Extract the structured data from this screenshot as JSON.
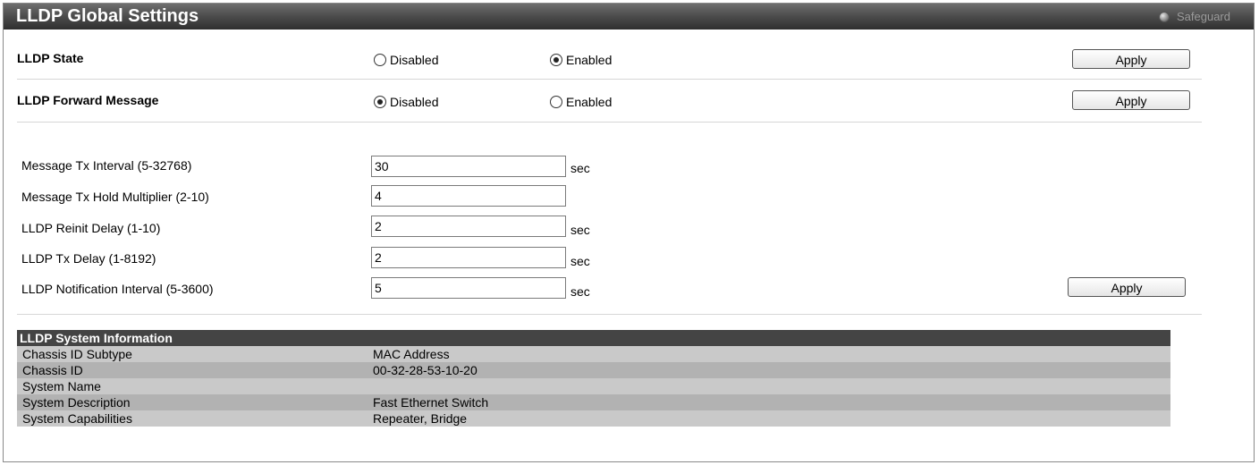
{
  "title": "LLDP Global Settings",
  "safeguard": {
    "label": "Safeguard",
    "icon": "status-dot-icon"
  },
  "lldp_state": {
    "label": "LLDP State",
    "options": [
      {
        "label": "Disabled",
        "checked": false
      },
      {
        "label": "Enabled",
        "checked": true
      }
    ],
    "apply": "Apply"
  },
  "lldp_forward": {
    "label": "LLDP Forward Message",
    "options": [
      {
        "label": "Disabled",
        "checked": true
      },
      {
        "label": "Enabled",
        "checked": false
      }
    ],
    "apply": "Apply"
  },
  "params": [
    {
      "label": "Message Tx Interval (5-32768)",
      "value": "30",
      "unit": "sec"
    },
    {
      "label": "Message Tx Hold Multiplier (2-10)",
      "value": "4",
      "unit": ""
    },
    {
      "label": "LLDP Reinit Delay (1-10)",
      "value": "2",
      "unit": "sec"
    },
    {
      "label": "LLDP Tx Delay (1-8192)",
      "value": "2",
      "unit": "sec"
    },
    {
      "label": "LLDP Notification Interval (5-3600)",
      "value": "5",
      "unit": "sec"
    }
  ],
  "params_apply": "Apply",
  "system_info": {
    "header": "LLDP System Information",
    "rows": [
      {
        "key": "Chassis ID Subtype",
        "value": "MAC Address"
      },
      {
        "key": "Chassis ID",
        "value": "00-32-28-53-10-20"
      },
      {
        "key": "System Name",
        "value": ""
      },
      {
        "key": "System Description",
        "value": "Fast Ethernet Switch"
      },
      {
        "key": "System Capabilities",
        "value": "Repeater, Bridge"
      }
    ]
  }
}
